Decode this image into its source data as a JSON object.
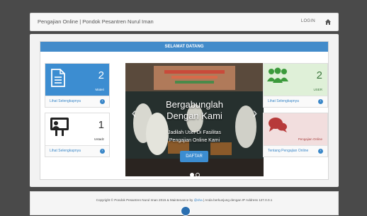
{
  "navbar": {
    "brand": "Pengajian Online | Pondok Pesantren Nurul Iman",
    "login": "LOGIN",
    "home_icon": "home-icon"
  },
  "panel": {
    "title": "SELAMAT DATANG"
  },
  "cards": {
    "materi": {
      "count": "2",
      "label": "Materi",
      "link": "Lihat Selengkapnya",
      "icon": "document-icon"
    },
    "ustadz": {
      "count": "1",
      "label": "Ustadz",
      "link": "Lihat Selengkapnya",
      "icon": "chalkboard-teacher-icon"
    },
    "user": {
      "count": "2",
      "label": "USER",
      "link": "Lihat Selengkapnya",
      "icon": "users-icon"
    },
    "pengajian": {
      "label": "Pengajian Online",
      "link": "Tentang Pengajian Online",
      "icon": "chat-bubbles-icon"
    }
  },
  "slider": {
    "heading_line1": "Bergabunglah",
    "heading_line2": "Dengan Kami",
    "text_line1": "Jadilah User Di Fasilitas",
    "text_line2": "Pengajian Online Kami",
    "button": "DAFTAR",
    "prev": "‹",
    "next": "›",
    "active_slide": 1,
    "total_slides": 2
  },
  "footer": {
    "text_before": "Copyright © Pondok Pesantren Nurul Iman 2015 & Maintenance by ",
    "link": "@sha",
    "text_after": " | Anda berkunjung dengan IP Address 127.0.0.1"
  },
  "colors": {
    "primary": "#428bca",
    "card_blue": "#3c8dd1",
    "card_green": "#dff0d8",
    "card_pink": "#f2dede",
    "background": "#4a4a4a"
  }
}
